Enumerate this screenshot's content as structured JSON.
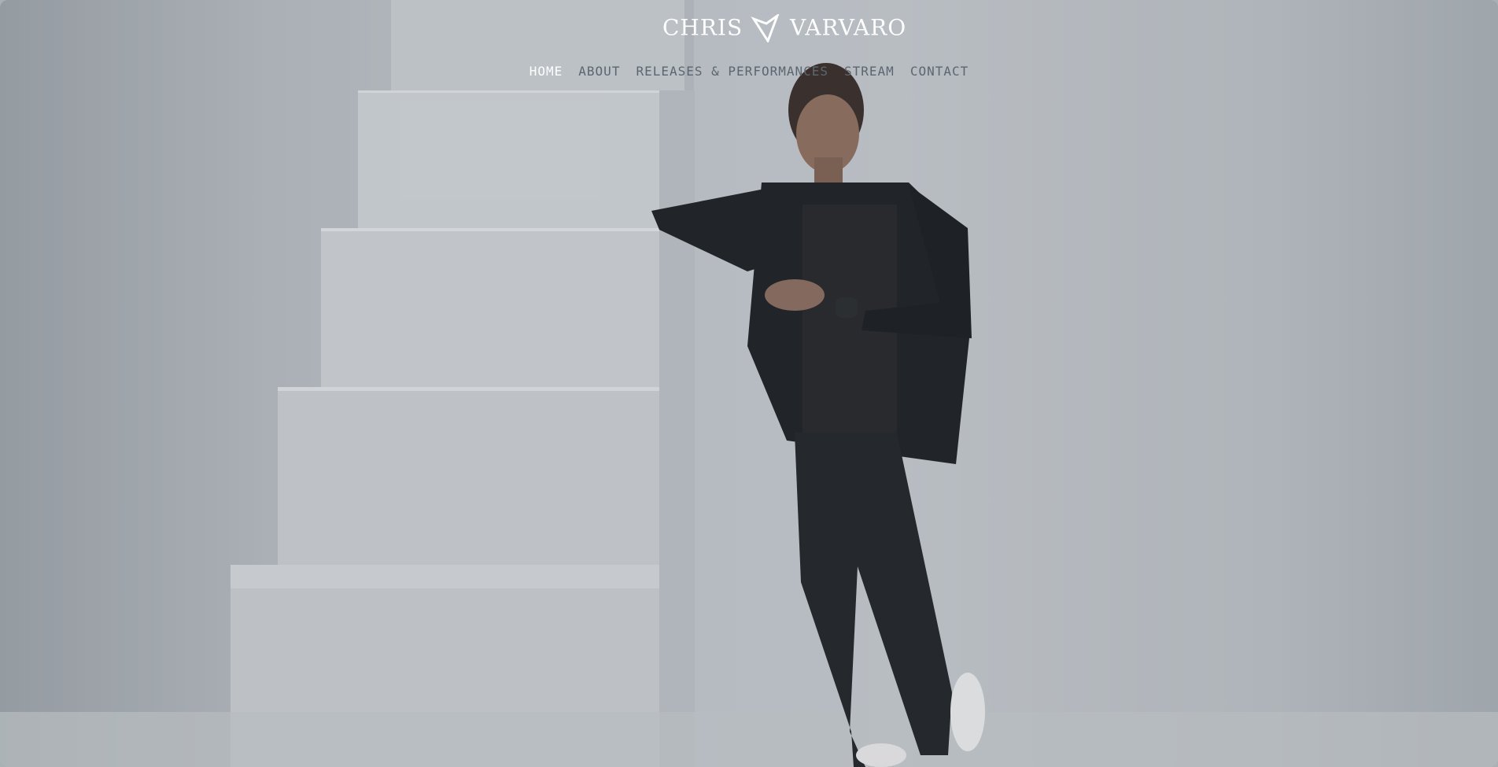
{
  "brand": {
    "name_left": "CHRIS",
    "name_right": "VARVARO",
    "logo_icon": "chris-varvaro-v-logo",
    "text_color": "#ffffff"
  },
  "nav": {
    "items": [
      {
        "label": "HOME",
        "active": true
      },
      {
        "label": "ABOUT",
        "active": false
      },
      {
        "label": "RELEASES & PERFORMANCES",
        "active": false
      },
      {
        "label": "STREAM",
        "active": false
      },
      {
        "label": "CONTACT",
        "active": false
      }
    ],
    "active_color": "#ffffff",
    "inactive_color": "#5c6670"
  },
  "hero": {
    "image": "photo of man in black leather jacket leaning on white staircase",
    "background_color": "#bfc5ca"
  }
}
